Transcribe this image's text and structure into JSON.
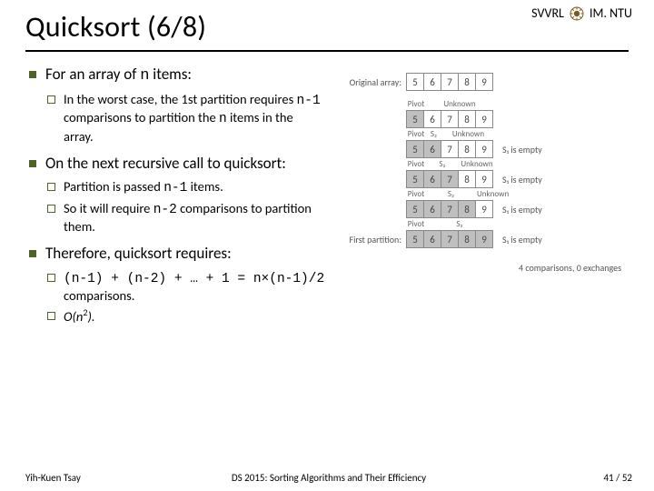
{
  "brand": {
    "left": "SVVRL",
    "right": "IM. NTU",
    "logo_name": "ntu-crest-icon"
  },
  "title": "Quicksort (6/8)",
  "bullets": [
    {
      "text_pre": "For an array of ",
      "mono": "n",
      "text_post": " items:",
      "sub": [
        {
          "parts": [
            "In the worst case, the 1st partition requires ",
            "n-1",
            " comparisons to partition the ",
            "n",
            " items in the array."
          ]
        }
      ]
    },
    {
      "text_pre": "On the next recursive call to quicksort:",
      "mono": "",
      "text_post": "",
      "sub": [
        {
          "parts": [
            "Partition is passed ",
            "n-1",
            " items."
          ]
        },
        {
          "parts": [
            "So it will require ",
            "n-2",
            " comparisons to partition them."
          ]
        }
      ]
    },
    {
      "text_pre": "Therefore, quicksort requires:",
      "mono": "",
      "text_post": "",
      "sub": [
        {
          "mono_block": "(n-1) + (n-2) + … + 1 = n×(n-1)/2",
          "tail": " comparisons."
        },
        {
          "bigO_pre": "O(",
          "bigO_var": "n",
          "bigO_exp": "2",
          "bigO_post": ")."
        }
      ]
    }
  ],
  "diagram": {
    "original_label": "Original array:",
    "original": [
      "5",
      "6",
      "7",
      "8",
      "9"
    ],
    "steps": [
      {
        "pivot_label": "Pivot",
        "seg_labels": [
          "",
          "Unknown"
        ],
        "cells": [
          "5",
          "6",
          "7",
          "8",
          "9"
        ],
        "shaded": [
          0
        ],
        "right_label": ""
      },
      {
        "pivot_label": "Pivot",
        "seg_labels": [
          "S₂",
          "Unknown"
        ],
        "cells": [
          "5",
          "6",
          "7",
          "8",
          "9"
        ],
        "shaded": [
          0,
          1
        ],
        "right_label": "S₁ is empty"
      },
      {
        "pivot_label": "Pivot",
        "seg_labels": [
          "S₂",
          "Unknown"
        ],
        "cells": [
          "5",
          "6",
          "7",
          "8",
          "9"
        ],
        "shaded": [
          0,
          1,
          2
        ],
        "right_label": "S₁ is empty"
      },
      {
        "pivot_label": "Pivot",
        "seg_labels": [
          "S₂",
          "Unknown"
        ],
        "cells": [
          "5",
          "6",
          "7",
          "8",
          "9"
        ],
        "shaded": [
          0,
          1,
          2,
          3
        ],
        "right_label": "S₁ is empty"
      },
      {
        "pivot_label": "Pivot",
        "seg_labels": [
          "S₂",
          ""
        ],
        "cells": [
          "5",
          "6",
          "7",
          "8",
          "9"
        ],
        "shaded": [
          0,
          1,
          2,
          3,
          4
        ],
        "right_label": "S₁ is empty"
      }
    ],
    "first_partition_label": "First partition:",
    "caption": "4 comparisons, 0 exchanges"
  },
  "footer": {
    "left": "Yih-Kuen Tsay",
    "center": "DS 2015: Sorting Algorithms and Their Efficiency",
    "page_current": "41",
    "page_sep": " / ",
    "page_total": "52"
  }
}
